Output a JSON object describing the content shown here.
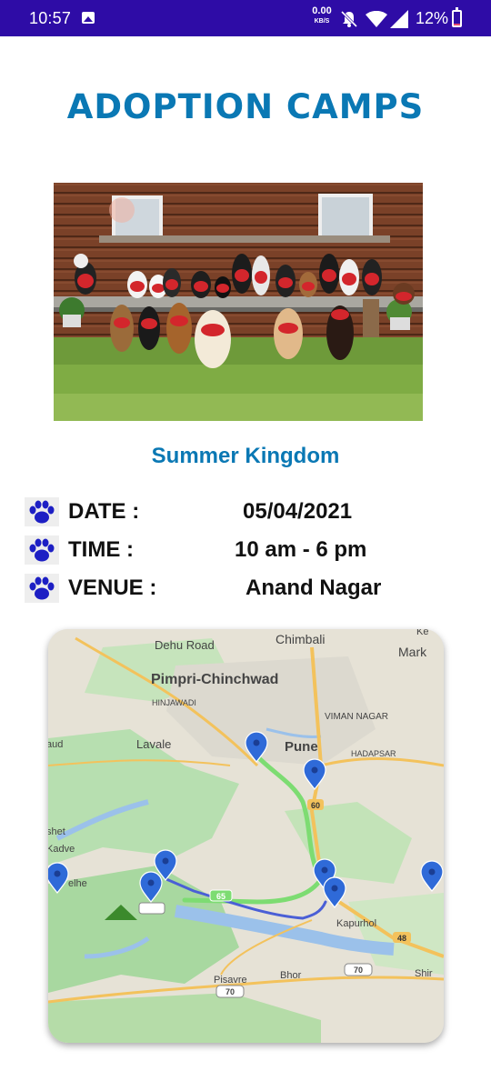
{
  "status_bar": {
    "time": "10:57",
    "net_speed_value": "0.00",
    "net_speed_unit": "KB/S",
    "battery": "12%",
    "icons": [
      "gallery-icon",
      "mute-bell-icon",
      "wifi-icon",
      "signal-icon",
      "battery-icon"
    ],
    "battery_level": 0.12
  },
  "page": {
    "title": "ADOPTION CAMPS",
    "camp_name": "Summer Kingdom"
  },
  "details": [
    {
      "label": "DATE :",
      "value": "05/04/2021",
      "icon": "paw-icon"
    },
    {
      "label": "TIME :",
      "value": "10 am - 6 pm",
      "icon": "paw-icon"
    },
    {
      "label": "VENUE :",
      "value": "Anand Nagar",
      "icon": "paw-icon"
    }
  ],
  "map": {
    "labels": {
      "dehu_road": "Dehu Road",
      "chimbali": "Chimbali",
      "mark": "Mark",
      "ke": "Ke",
      "pimpri": "Pimpri-Chinchwad",
      "hinjawadi": "HINJAWADI",
      "viman": "VIMAN NAGAR",
      "aud": "aud",
      "lavale": "Lavale",
      "pune": "Pune",
      "hadapsar": "HADAPSAR",
      "shet": "shet",
      "kadve": "Kadve",
      "elhe": "elhe",
      "kapurhol": "Kapurhol",
      "pisavre": "Pisavre",
      "bhor": "Bhor",
      "shir": "Shir",
      "r60": "60",
      "r65": "65",
      "r48": "48",
      "r70a": "70",
      "r70b": "70"
    },
    "colors": {
      "land": "#e6e2d6",
      "green": "#b7dfb0",
      "water": "#9bc1ea",
      "road": "#f3c25c",
      "route_active": "#7ddc72",
      "route_alt": "#4a5fd6",
      "pin": "#2f6ad8"
    }
  }
}
